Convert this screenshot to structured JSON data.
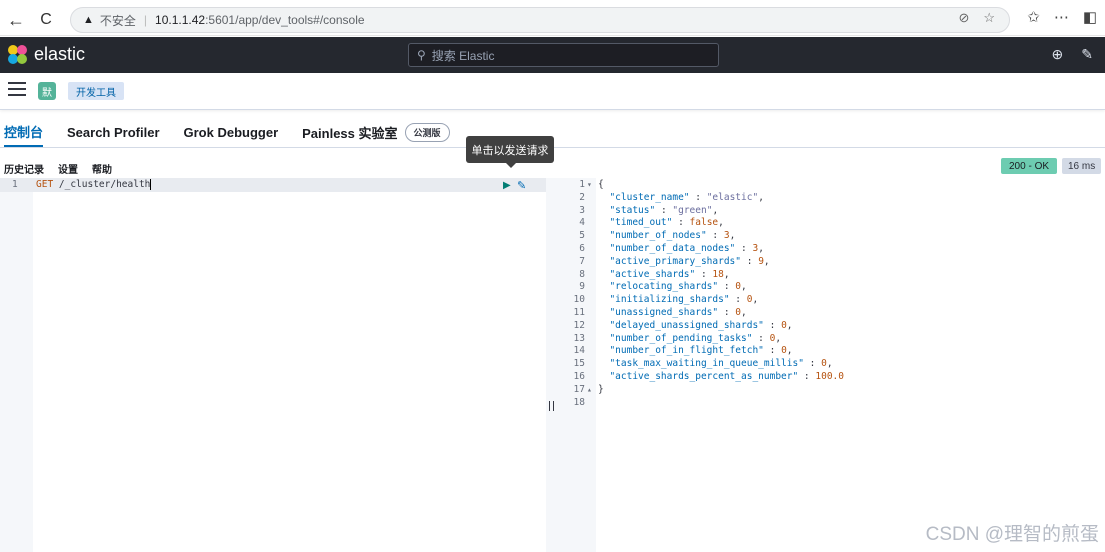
{
  "browser": {
    "back_icon": "←",
    "reload_icon": "C",
    "warning_icon": "▲",
    "insecure_label": "不安全",
    "separator": "|",
    "host": "10.1.1.42",
    "path": ":5601/app/dev_tools#/console"
  },
  "header": {
    "app_name": "elastic",
    "search_placeholder": "搜索 Elastic"
  },
  "breadcrumb": {
    "space_initial": "默",
    "current": "开发工具"
  },
  "tabs": [
    {
      "label": "控制台",
      "active": true
    },
    {
      "label": "Search Profiler",
      "active": false
    },
    {
      "label": "Grok Debugger",
      "active": false
    },
    {
      "label": "Painless 实验室",
      "active": false,
      "badge": "公测版"
    }
  ],
  "console_menu": {
    "history": "历史记录",
    "settings": "设置",
    "help": "帮助"
  },
  "tooltip": "单击以发送请求",
  "status": {
    "code": "200 - OK",
    "time": "16 ms"
  },
  "request": {
    "line_number": "1",
    "method": "GET",
    "path": " /_cluster/health"
  },
  "response": {
    "lines": [
      {
        "n": "1",
        "fold": "▾",
        "text": "{"
      },
      {
        "n": "2",
        "key": "\"cluster_name\"",
        "value": "\"elastic\"",
        "vtype": "s",
        "comma": ","
      },
      {
        "n": "3",
        "key": "\"status\"",
        "value": "\"green\"",
        "vtype": "s",
        "comma": ","
      },
      {
        "n": "4",
        "key": "\"timed_out\"",
        "value": "false",
        "vtype": "num",
        "comma": ","
      },
      {
        "n": "5",
        "key": "\"number_of_nodes\"",
        "value": "3",
        "vtype": "num",
        "comma": ","
      },
      {
        "n": "6",
        "key": "\"number_of_data_nodes\"",
        "value": "3",
        "vtype": "num",
        "comma": ","
      },
      {
        "n": "7",
        "key": "\"active_primary_shards\"",
        "value": "9",
        "vtype": "num",
        "comma": ","
      },
      {
        "n": "8",
        "key": "\"active_shards\"",
        "value": "18",
        "vtype": "num",
        "comma": ","
      },
      {
        "n": "9",
        "key": "\"relocating_shards\"",
        "value": "0",
        "vtype": "num",
        "comma": ","
      },
      {
        "n": "10",
        "key": "\"initializing_shards\"",
        "value": "0",
        "vtype": "num",
        "comma": ","
      },
      {
        "n": "11",
        "key": "\"unassigned_shards\"",
        "value": "0",
        "vtype": "num",
        "comma": ","
      },
      {
        "n": "12",
        "key": "\"delayed_unassigned_shards\"",
        "value": "0",
        "vtype": "num",
        "comma": ","
      },
      {
        "n": "13",
        "key": "\"number_of_pending_tasks\"",
        "value": "0",
        "vtype": "num",
        "comma": ","
      },
      {
        "n": "14",
        "key": "\"number_of_in_flight_fetch\"",
        "value": "0",
        "vtype": "num",
        "comma": ","
      },
      {
        "n": "15",
        "key": "\"task_max_waiting_in_queue_millis\"",
        "value": "0",
        "vtype": "num",
        "comma": ","
      },
      {
        "n": "16",
        "key": "\"active_shards_percent_as_number\"",
        "value": "100.0",
        "vtype": "num",
        "comma": ""
      },
      {
        "n": "17",
        "fold": "▴",
        "text": "}"
      },
      {
        "n": "18",
        "text": ""
      }
    ]
  },
  "watermark": "CSDN @理智的煎蛋"
}
